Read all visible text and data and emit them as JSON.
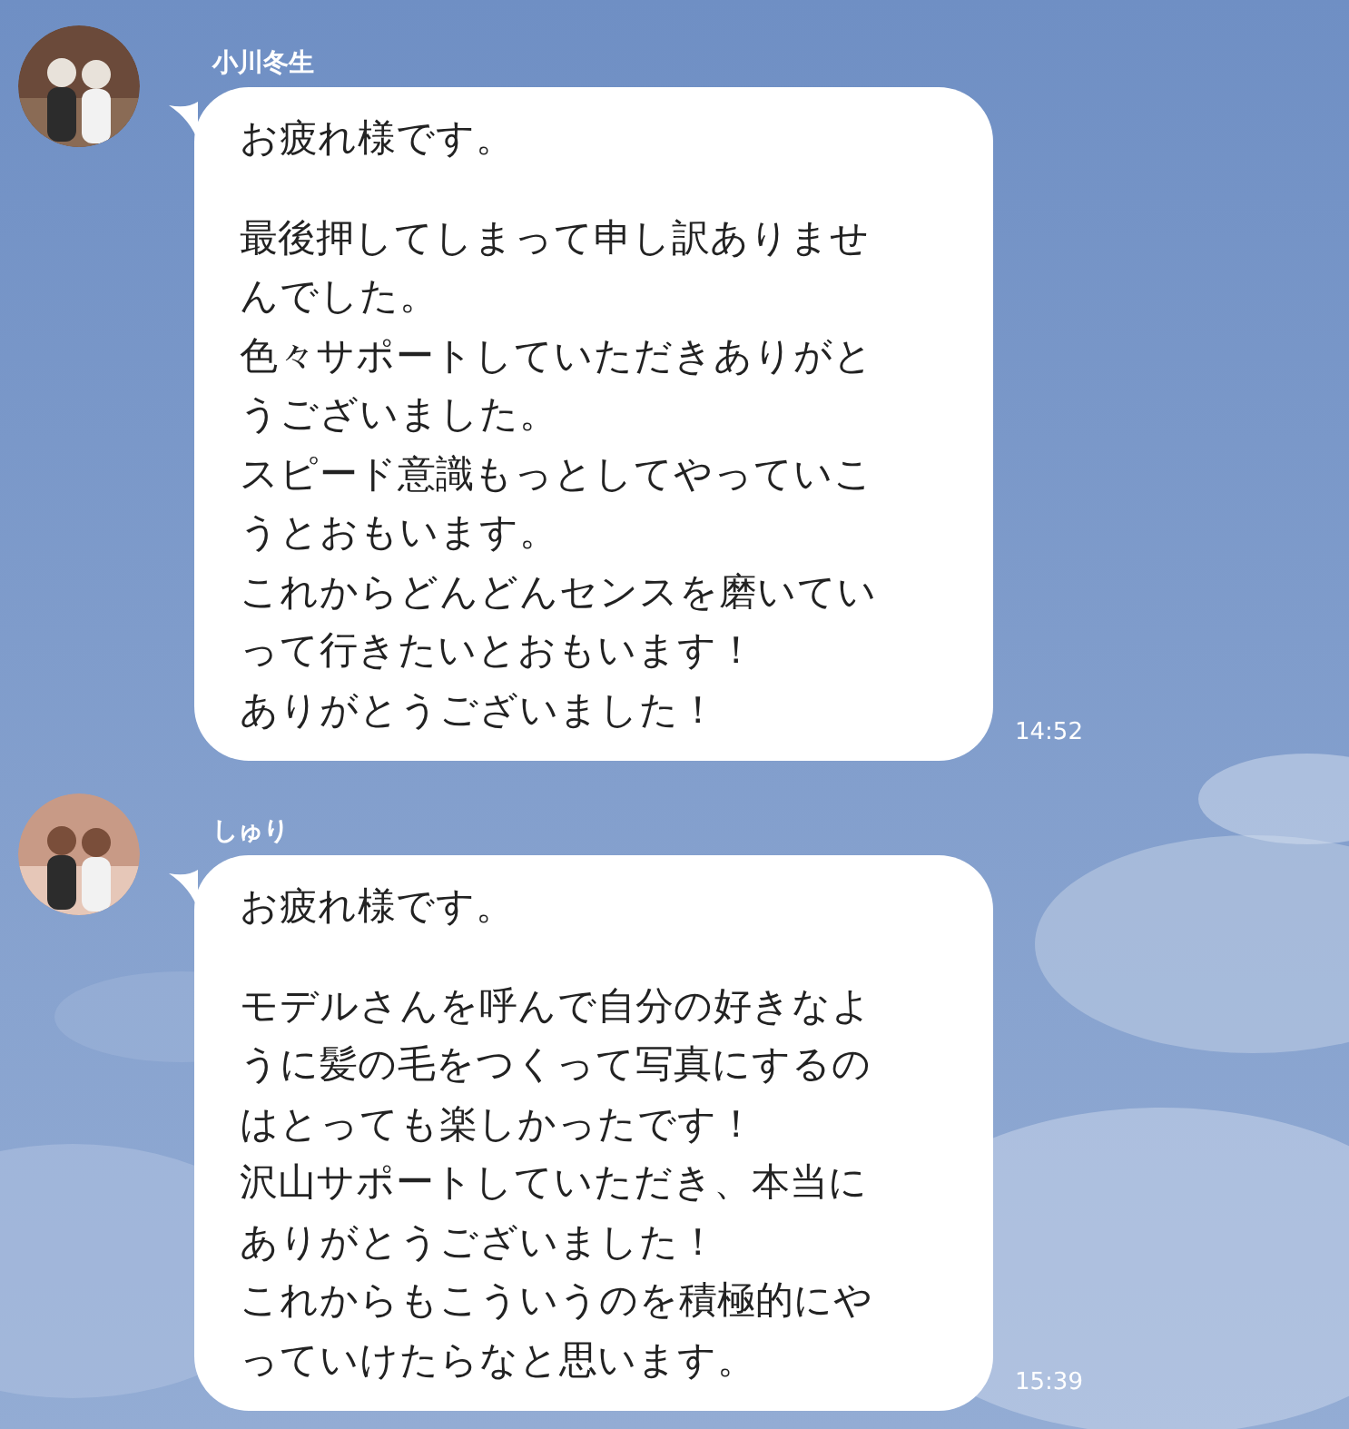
{
  "messages": [
    {
      "sender": "小川冬生",
      "paragraphs": [
        "お疲れ様です。",
        "最後押してしまって申し訳ありませんでした。",
        "色々サポートしていただきありがとうございました。",
        "スピード意識もっとしてやっていこうとおもいます。",
        "これからどんどんセンスを磨いていって行きたいとおもいます！",
        "ありがとうございました！"
      ],
      "time": "14:52"
    },
    {
      "sender": "しゅり",
      "paragraphs": [
        "お疲れ様です。",
        "モデルさんを呼んで自分の好きなように髪の毛をつくって写真にするのはとっても楽しかったです！",
        "沢山サポートしていただき、本当にありがとうございました！",
        "これからもこういうのを積極的にやっていけたらなと思います。"
      ],
      "time": "15:39"
    }
  ]
}
